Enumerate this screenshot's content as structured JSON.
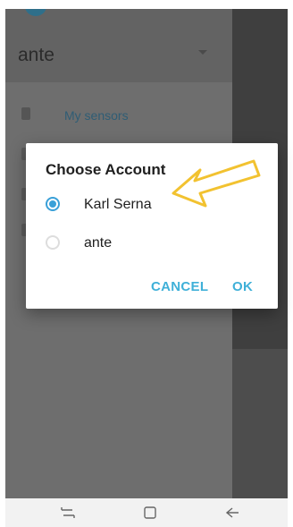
{
  "drawer": {
    "account_name": "ante",
    "items": [
      {
        "label": "My sensors",
        "icon": "phone-icon"
      },
      {
        "label": "",
        "icon": "person-icon"
      },
      {
        "label": "",
        "icon": "settings-icon"
      },
      {
        "label": "",
        "icon": "info-icon"
      }
    ]
  },
  "dialog": {
    "title": "Choose Account",
    "options": [
      {
        "label": "Karl Serna",
        "selected": true
      },
      {
        "label": "ante",
        "selected": false
      }
    ],
    "cancel_label": "CANCEL",
    "ok_label": "OK"
  },
  "annotation": {
    "type": "arrow",
    "color": "#f2c230",
    "points_to": "Karl Serna"
  },
  "navbar": {
    "icons": [
      "recent-apps-icon",
      "home-icon",
      "back-icon"
    ]
  },
  "colors": {
    "accent": "#3aa0d8",
    "button_text": "#3fb0d8",
    "annotation_arrow": "#f2c230"
  }
}
